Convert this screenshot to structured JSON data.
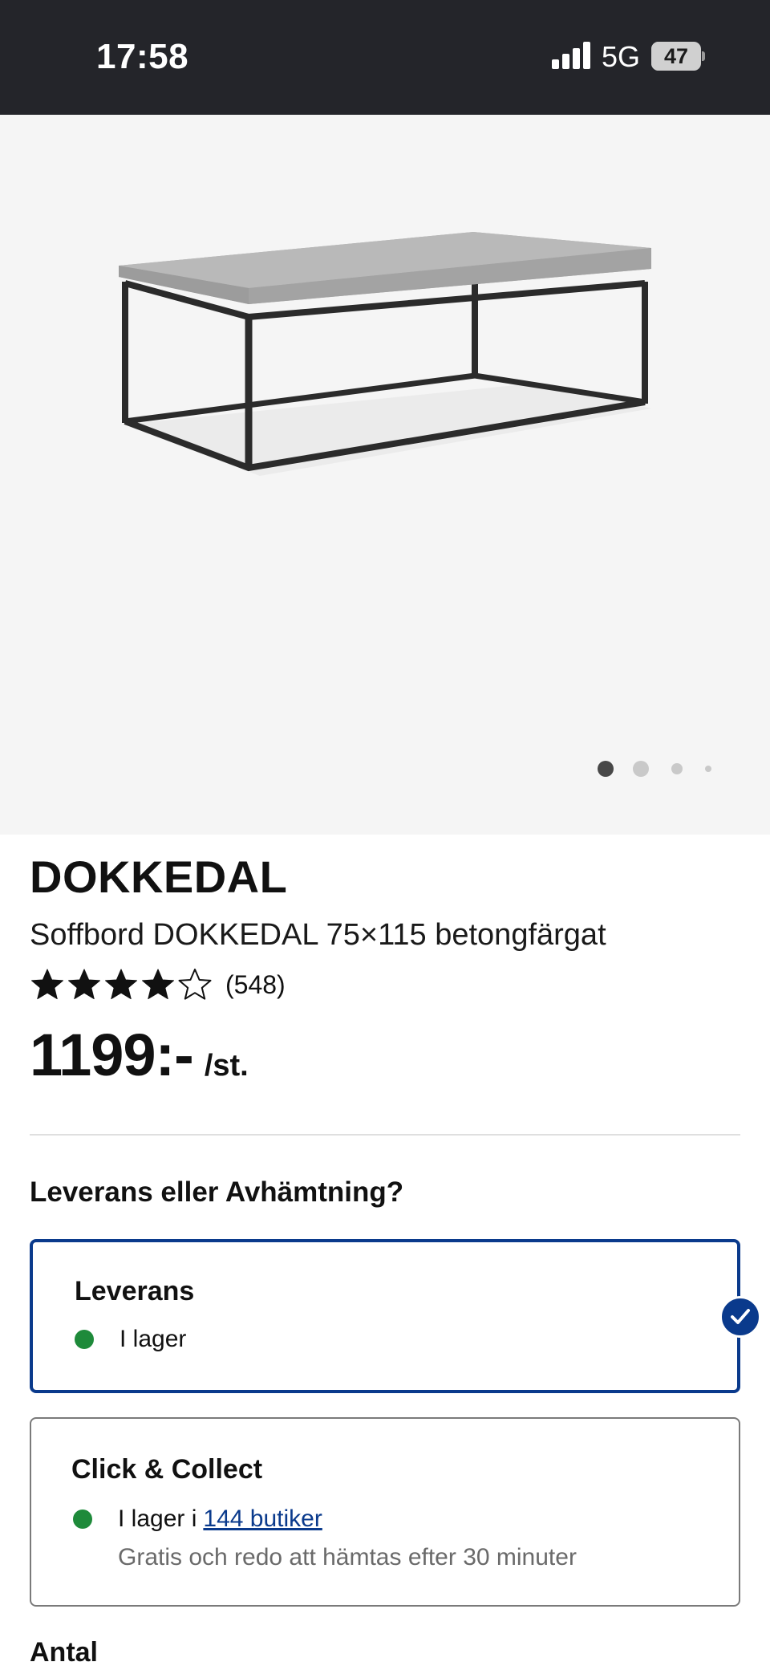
{
  "status_bar": {
    "time": "17:58",
    "network": "5G",
    "battery": "47",
    "battery_level_percent": 47,
    "icons": [
      "signal-bars-icon",
      "battery-icon"
    ]
  },
  "gallery": {
    "image_name": "coffee-table-image",
    "page_count": 4,
    "active_index": 0
  },
  "product": {
    "brand": "DOKKEDAL",
    "description": "Soffbord DOKKEDAL 75×115 betongfärgat",
    "rating_stars": 4,
    "rating_max": 5,
    "rating_count": "(548)",
    "price": "1199:-",
    "price_unit": "/st."
  },
  "fulfillment": {
    "question": "Leverans eller Avhämtning?",
    "delivery": {
      "title": "Leverans",
      "stock": "I lager",
      "selected": true
    },
    "collect": {
      "title": "Click & Collect",
      "stock_prefix": "I lager i",
      "stock_link": "144 butiker",
      "subtext": "Gratis och redo att hämtas efter 30 minuter",
      "selected": false
    }
  },
  "quantity": {
    "label": "Antal"
  },
  "colors": {
    "status_bar_bg": "#24252a",
    "selected_border": "#0a3a8c",
    "in_stock": "#1e8a3a",
    "link": "#0a3a8c"
  }
}
